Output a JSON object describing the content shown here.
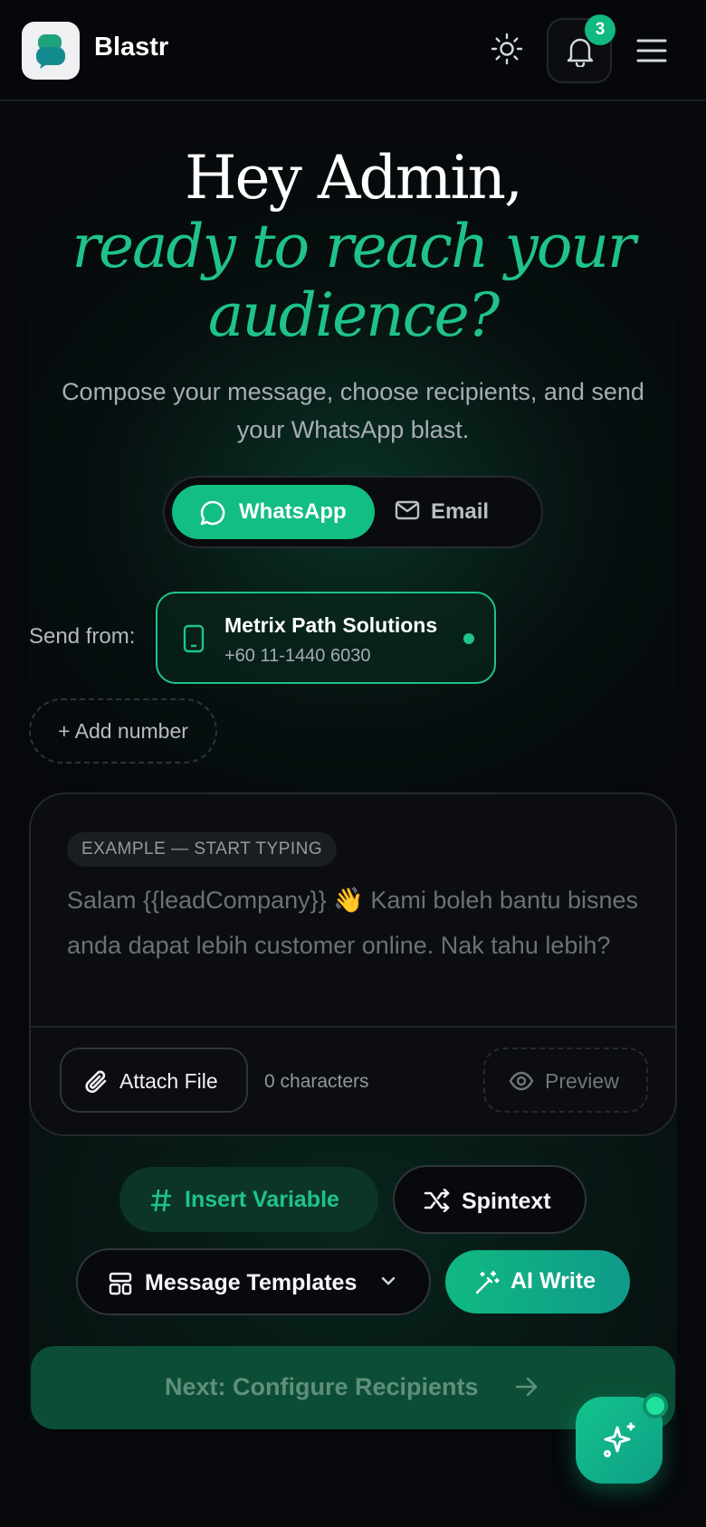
{
  "header": {
    "brand": "Blastr",
    "notification_count": "3",
    "icons": [
      "logo-icon",
      "sun-icon",
      "bell-icon",
      "menu-icon"
    ]
  },
  "hero": {
    "greeting": "Hey Admin,",
    "headline_line1": "ready to reach your",
    "headline_line2": "audience?",
    "subtitle": "Compose your message, choose recipients, and send your WhatsApp blast."
  },
  "channel_toggle": {
    "whatsapp_label": "WhatsApp",
    "email_label": "Email",
    "selected": "WhatsApp"
  },
  "sender": {
    "label": "Send from:",
    "name": "Metrix Path Solutions",
    "number": "+60 11-1440 6030",
    "add_label": "+ Add number"
  },
  "composer": {
    "example_tag": "EXAMPLE — START TYPING",
    "placeholder": "Salam {{leadCompany}} 👋 Kami boleh bantu bisnes anda dapat lebih customer online. Nak tahu lebih?",
    "attach_label": "Attach File",
    "char_count": "0 characters",
    "preview_label": "Preview"
  },
  "actions": {
    "insert_variable": "Insert Variable",
    "spintext": "Spintext",
    "templates": "Message Templates",
    "ai_write": "AI Write",
    "next": "Next: Configure Recipients"
  },
  "colors": {
    "accent": "#12be82",
    "background": "#06080b",
    "next_button": "#0b4e35"
  }
}
